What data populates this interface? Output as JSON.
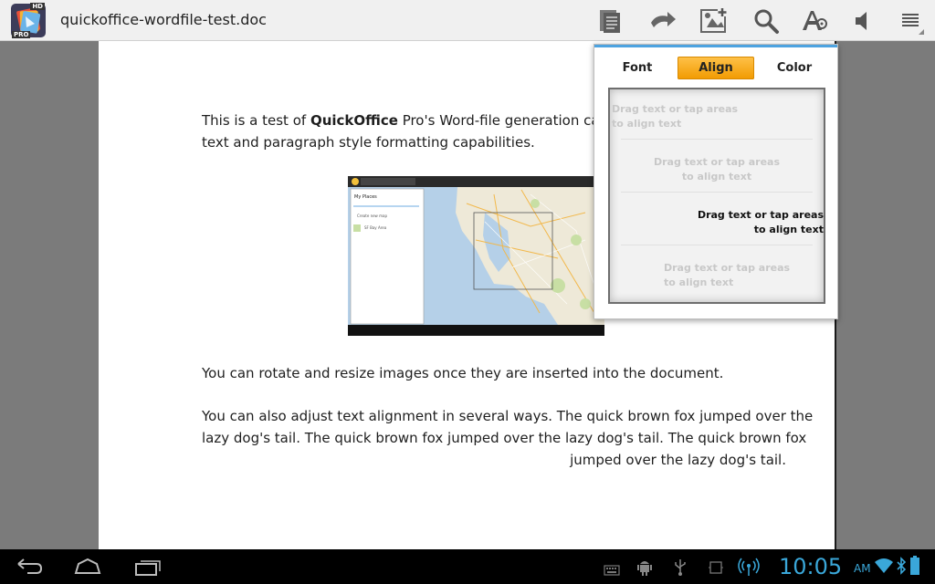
{
  "header": {
    "doc_title": "quickoffice-wordfile-test.doc",
    "app_icon": "quickoffice-pro-hd-icon",
    "app_badge_top": "HD",
    "app_badge_bottom": "PRO",
    "icons": [
      "document-view-icon",
      "undo-icon",
      "add-image-icon",
      "search-icon",
      "text-format-icon",
      "speaker-icon",
      "menu-icon"
    ]
  },
  "document": {
    "para1_prefix": "This is a test of ",
    "para1_bold": "QuickOffice",
    "para1_line1_rest": " Pro's Word-file generation capab",
    "para1_line2": "text and paragraph style formatting capabilities.",
    "para2": "You can rotate and resize images once they are inserted into the document.",
    "para3_line1": "You can also adjust text alignment in several ways.  The quick brown fox jumped over the",
    "para3_line2": "lazy dog's tail. The quick brown fox jumped over the lazy dog's tail. The quick brown fox",
    "para3_line3": "jumped over the lazy dog's tail.",
    "map": {
      "panel_title": "My Places",
      "item1": "Create new map",
      "item2": "SF Bay Area"
    }
  },
  "popup": {
    "tabs": [
      {
        "label": "Font",
        "active": false
      },
      {
        "label": "Align",
        "active": true
      },
      {
        "label": "Color",
        "active": false
      }
    ],
    "align_options": [
      {
        "line1": "Drag text or tap areas",
        "line2": "to align text",
        "align": "left",
        "selected": false
      },
      {
        "line1": "Drag text or tap areas",
        "line2": "to align text",
        "align": "center",
        "selected": false
      },
      {
        "line1": "Drag text or tap areas",
        "line2": "to align text",
        "align": "right",
        "selected": true
      },
      {
        "line1": "Drag  text  or  tap  areas",
        "line2": "to align text",
        "align": "justify",
        "selected": false
      }
    ],
    "accent_color": "#f5a623"
  },
  "sysbar": {
    "time": "10:05",
    "ampm": "AM",
    "nav_icons": [
      "back-icon",
      "home-icon",
      "recent-apps-icon"
    ],
    "status_icons": [
      "keyboard-icon",
      "android-debug-icon",
      "usb-icon",
      "screen-rotation-icon",
      "wireless-icon",
      "wifi-icon",
      "bluetooth-icon",
      "battery-icon"
    ],
    "clock_color": "#3aa7d9"
  }
}
